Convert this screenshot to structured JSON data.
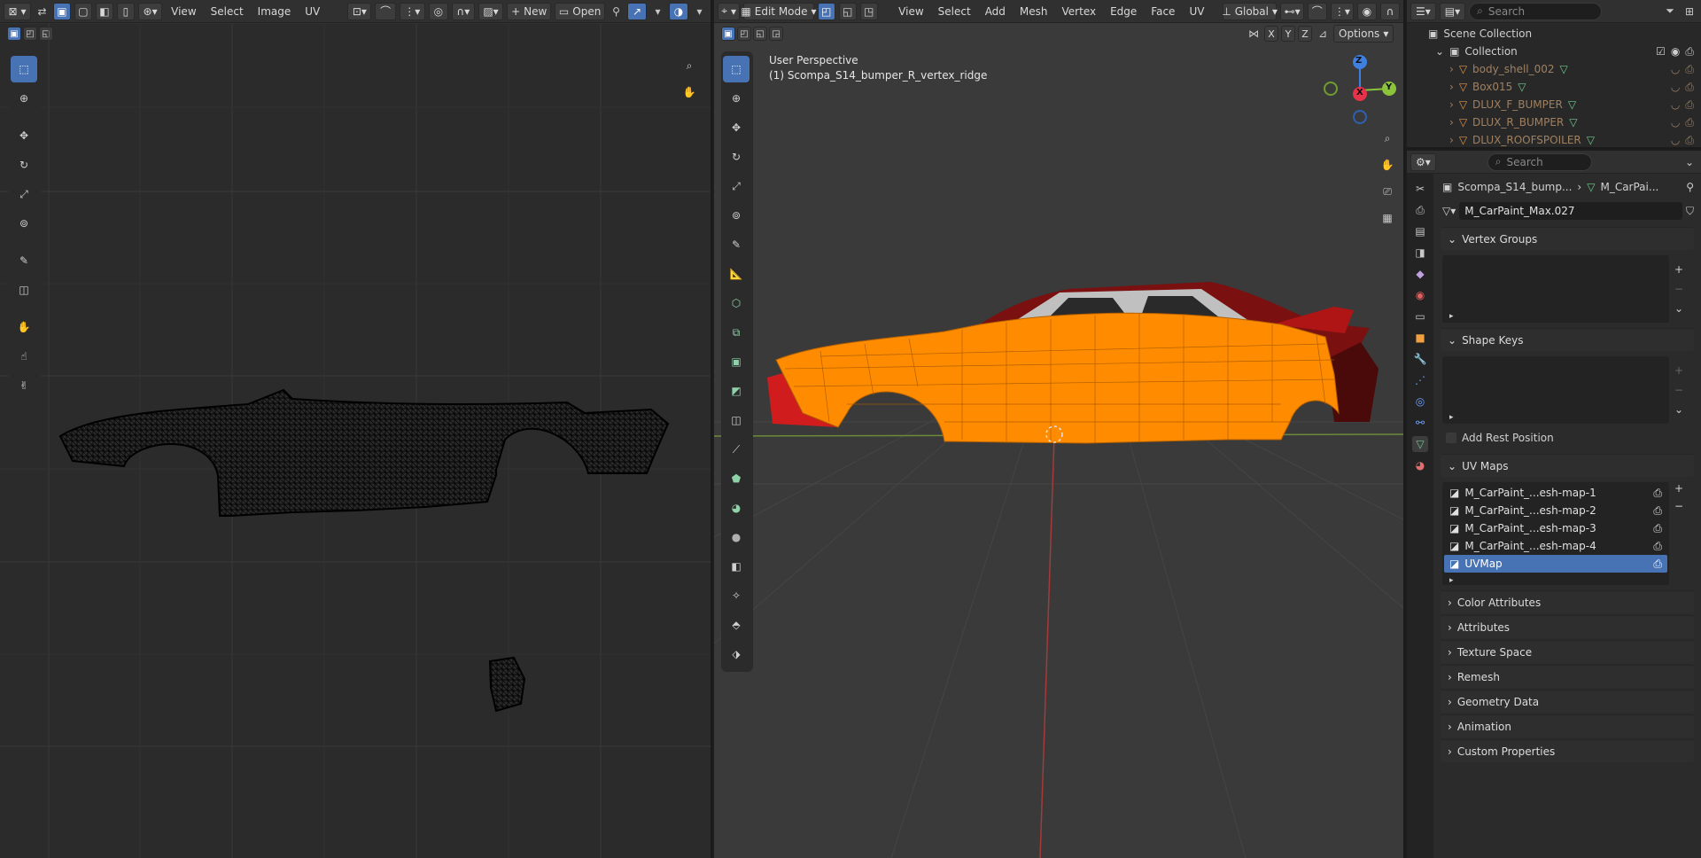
{
  "uv_editor": {
    "menus": [
      "View",
      "Select",
      "Image",
      "UV"
    ],
    "new_label": "New",
    "open_label": "Open"
  },
  "viewport": {
    "mode": "Edit Mode",
    "menus": [
      "View",
      "Select",
      "Add",
      "Mesh",
      "Vertex",
      "Edge",
      "Face",
      "UV"
    ],
    "transform_orientation": "Global",
    "axes": [
      "X",
      "Y",
      "Z"
    ],
    "options_label": "Options",
    "perspective": "User Perspective",
    "object_label": "(1) Scompa_S14_bumper_R_vertex_ridge",
    "gizmo": {
      "z": "Z",
      "y": "Y",
      "x": "X"
    }
  },
  "outliner": {
    "search_placeholder": "Search",
    "scene_collection": "Scene Collection",
    "collection": "Collection",
    "items": [
      "body_shell_002",
      "Box015",
      "DLUX_F_BUMPER",
      "DLUX_R_BUMPER",
      "DLUX_ROOFSPOILER"
    ]
  },
  "properties": {
    "search_placeholder": "Search",
    "breadcrumb_object": "Scompa_S14_bump...",
    "breadcrumb_mesh": "M_CarPai...",
    "mesh_name": "M_CarPaint_Max.027",
    "sections": {
      "vertex_groups": "Vertex Groups",
      "shape_keys": "Shape Keys",
      "add_rest_position": "Add Rest Position",
      "uv_maps": "UV Maps",
      "color_attributes": "Color Attributes",
      "attributes": "Attributes",
      "texture_space": "Texture Space",
      "remesh": "Remesh",
      "geometry_data": "Geometry Data",
      "animation": "Animation",
      "custom_properties": "Custom Properties"
    },
    "uv_maps": [
      "M_CarPaint_...esh-map-1",
      "M_CarPaint_...esh-map-2",
      "M_CarPaint_...esh-map-3",
      "M_CarPaint_...esh-map-4",
      "UVMap"
    ],
    "uv_selected_index": 4
  },
  "colors": {
    "accent": "#4772b3",
    "mesh_selected": "#ff8c00",
    "car_paint": "#c81a1a",
    "axis_x": "#e8324a",
    "axis_y": "#8bc33a",
    "axis_z": "#3f7fe0"
  }
}
